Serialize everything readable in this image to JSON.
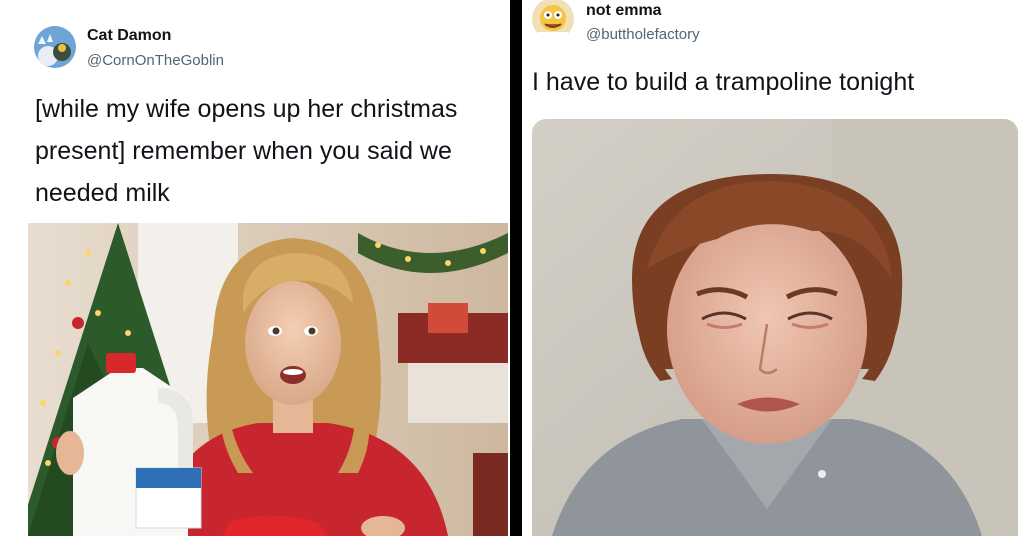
{
  "left_tweet": {
    "display_name": "Cat Damon",
    "handle": "@CornOnTheGoblin",
    "avatar_icon": "cat-avatar-icon",
    "text": "[while my wife opens up her christmas present] remember when you said we needed milk",
    "photo": "woman-opening-milk-jug-christmas-photo"
  },
  "right_tweet": {
    "display_name": "not emma",
    "handle": "@buttholefactory",
    "avatar_icon": "cartoon-avatar-icon",
    "text": "I have to build a trampoline tonight",
    "photo": "crying-woman-photo"
  },
  "colors": {
    "name": "#0f1419",
    "handle": "#536471",
    "divider": "#000000",
    "sweater_red": "#c8262e",
    "tree_green": "#2d5a2a"
  }
}
